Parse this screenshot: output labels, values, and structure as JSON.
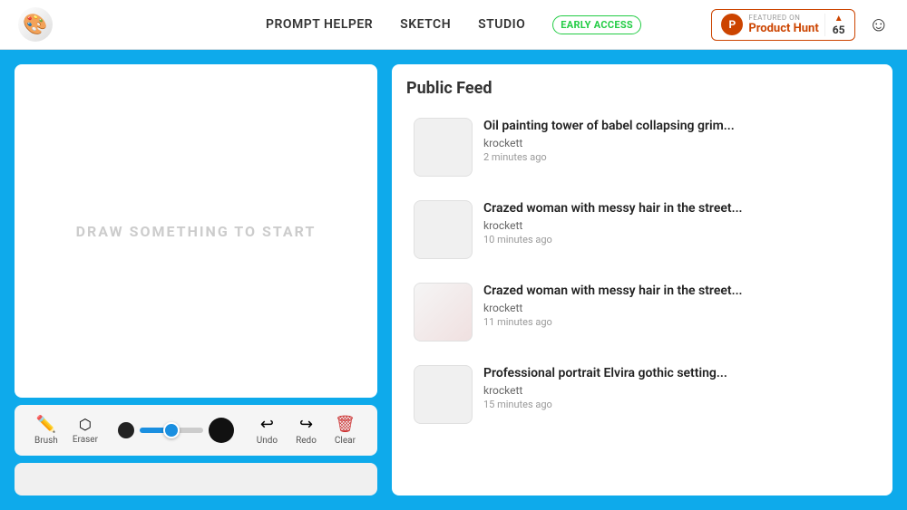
{
  "header": {
    "logo_emoji": "🎨",
    "nav": {
      "prompt_helper": "PROMPT HELPER",
      "sketch": "SKETCH",
      "studio": "STUDIO",
      "early_access": "EARLY ACCESS"
    },
    "product_hunt": {
      "featured_label": "FEATURED ON",
      "product_label": "Product Hunt",
      "arrow": "▲",
      "count": "65"
    },
    "smiley": "☺"
  },
  "canvas": {
    "placeholder": "DRAW SOMETHING TO START"
  },
  "toolbar": {
    "brush_label": "Brush",
    "eraser_label": "Eraser",
    "undo_label": "Undo",
    "redo_label": "Redo",
    "clear_label": "Clear",
    "brush_icon": "✏️",
    "eraser_icon": "⬜",
    "undo_icon": "↩",
    "redo_icon": "↪",
    "clear_icon": "🗑️"
  },
  "feed": {
    "title": "Public Feed",
    "items": [
      {
        "title": "Oil painting tower of babel collapsing grim...",
        "user": "krockett",
        "time": "2 minutes ago"
      },
      {
        "title": "Crazed woman with messy hair in the street...",
        "user": "krockett",
        "time": "10 minutes ago"
      },
      {
        "title": "Crazed woman with messy hair in the street...",
        "user": "krockett",
        "time": "11 minutes ago"
      },
      {
        "title": "Professional portrait Elvira gothic setting...",
        "user": "krockett",
        "time": "15 minutes ago"
      }
    ]
  }
}
